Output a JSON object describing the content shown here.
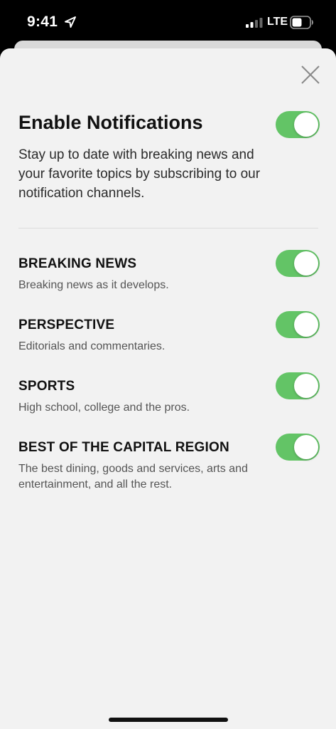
{
  "status_bar": {
    "time": "9:41",
    "network": "LTE",
    "icons": [
      "location-arrow-icon",
      "cellular-signal-icon",
      "battery-icon"
    ]
  },
  "header": {
    "close_icon": "close-icon",
    "title": "Enable Notifications",
    "description": "Stay up to date with breaking news and your favorite topics by subscribing to our notification channels.",
    "master_toggle_on": true
  },
  "channels": [
    {
      "title": "BREAKING NEWS",
      "description": "Breaking news as it develops.",
      "enabled": true
    },
    {
      "title": "PERSPECTIVE",
      "description": "Editorials and commentaries.",
      "enabled": true
    },
    {
      "title": "SPORTS",
      "description": "High school, college and the pros.",
      "enabled": true
    },
    {
      "title": "BEST OF THE CAPITAL REGION",
      "description": "The best dining, goods and services, arts and entertainment, and all the rest.",
      "enabled": true
    }
  ],
  "colors": {
    "toggle_on": "#63c466",
    "sheet_background": "#f2f2f2",
    "status_bar_background": "#000000"
  }
}
